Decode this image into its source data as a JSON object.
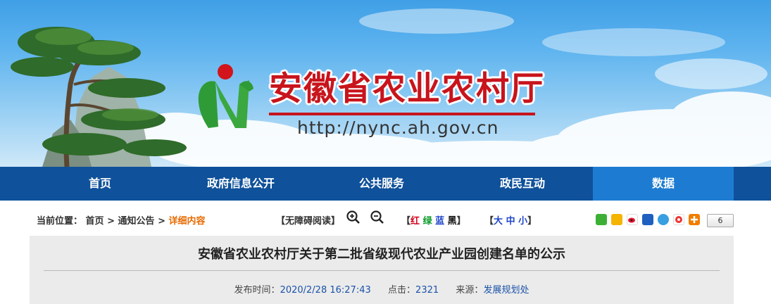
{
  "site": {
    "title": "安徽省农业农村厅",
    "url": "http://nync.ah.gov.cn",
    "logo_icon": "green-n-red-sun-logo",
    "brand_red": "#c8141c",
    "nav_blue": "#0f519a",
    "nav_active_blue": "#1d7cd2"
  },
  "nav": {
    "items": [
      {
        "label": "首页"
      },
      {
        "label": "政府信息公开"
      },
      {
        "label": "公共服务"
      },
      {
        "label": "政民互动"
      },
      {
        "label": "数据"
      }
    ],
    "active_index": 4
  },
  "breadcrumb": {
    "prefix": "当前位置：",
    "home": "首页",
    "sep1": " > ",
    "section": "通知公告",
    "sep2": "> ",
    "current": "详细内容"
  },
  "tools": {
    "accessible_reading": "【无障碍阅读】",
    "zoom_in_icon": "zoom-in-icon",
    "zoom_out_icon": "zoom-out-icon",
    "colors": {
      "open": "【",
      "red": "红",
      "green": "绿",
      "blue": "蓝",
      "black": "黑",
      "close": "】"
    },
    "sizes": {
      "open": "【",
      "large": "大",
      "medium": "中",
      "small": "小",
      "close": "】"
    }
  },
  "share": {
    "icons": [
      "wechat-icon",
      "qzone-icon",
      "weibo-icon",
      "renren-icon",
      "tencent-weibo-icon",
      "douban-icon",
      "more-share-icon"
    ],
    "count": "6"
  },
  "article": {
    "title": "安徽省农业农村厅关于第二批省级现代农业产业园创建名单的公示",
    "publish_label": "发布时间：",
    "publish_time": "2020/2/28 16:27:43",
    "clicks_label": "点击：",
    "clicks": "2321",
    "source_label": "来源：",
    "source": "发展规划处"
  }
}
